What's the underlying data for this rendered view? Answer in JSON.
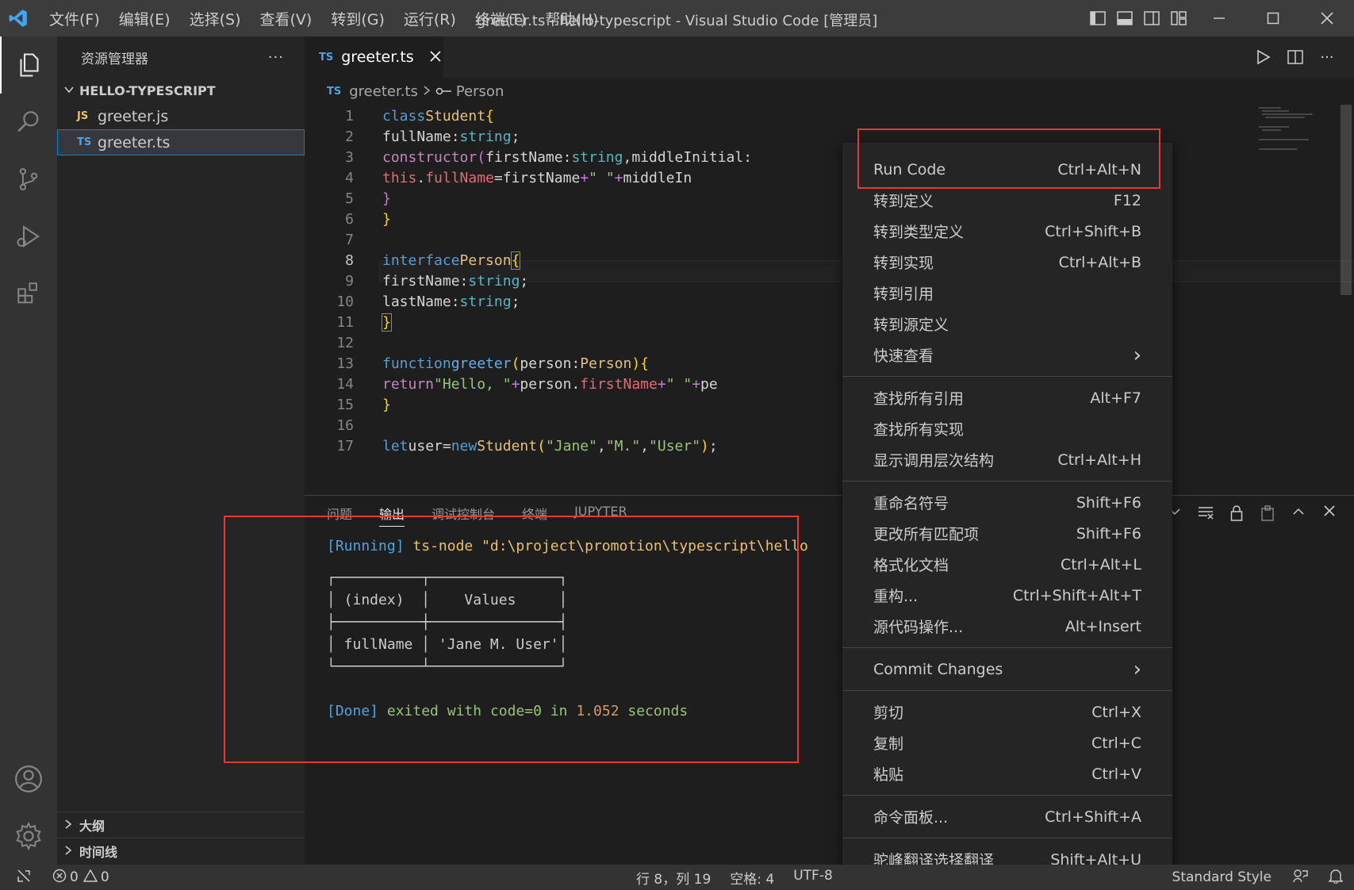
{
  "titlebar": {
    "menu": [
      "文件(F)",
      "编辑(E)",
      "选择(S)",
      "查看(V)",
      "转到(G)",
      "运行(R)",
      "终端(T)",
      "帮助(H)"
    ],
    "window_title": "greeter.ts - hello-typescript - Visual Studio Code [管理员]"
  },
  "sidebar": {
    "title": "资源管理器",
    "more": "···",
    "folder": "HELLO-TYPESCRIPT",
    "files": [
      {
        "badge": "JS",
        "name": "greeter.js"
      },
      {
        "badge": "TS",
        "name": "greeter.ts"
      }
    ],
    "outline": "大纲",
    "timeline": "时间线"
  },
  "tab": {
    "badge": "TS",
    "name": "greeter.ts"
  },
  "breadcrumb": {
    "file": "greeter.ts",
    "symbol": "Person"
  },
  "editor": {
    "current_line": 8,
    "line_numbers": [
      "1",
      "2",
      "3",
      "4",
      "5",
      "6",
      "7",
      "8",
      "9",
      "10",
      "11",
      "12",
      "13",
      "14",
      "15",
      "16",
      "17"
    ]
  },
  "panel": {
    "tabs": [
      "问题",
      "输出",
      "调试控制台",
      "终端",
      "JUPYTER"
    ],
    "active_tab": "输出",
    "running_tag": "[Running]",
    "running_cmd": "ts-node \"d:\\project\\promotion\\typescript\\hello",
    "table": {
      "top": "┌──────────┬───────────────┐",
      "header": "│ (index)  │    Values     │",
      "mid": "├──────────┼───────────────┤",
      "row": "│ fullName │ 'Jane M. User'│",
      "bottom": "└──────────┴───────────────┘"
    },
    "done_tag": "[Done]",
    "done_text": "exited with",
    "done_code": "code=0",
    "done_in": "in",
    "done_time": "1.052",
    "done_unit": "seconds"
  },
  "context_menu": {
    "groups": [
      [
        {
          "label": "Run Code",
          "kb": "Ctrl+Alt+N"
        },
        {
          "label": "转到定义",
          "kb": "F12"
        },
        {
          "label": "转到类型定义",
          "kb": "Ctrl+Shift+B"
        },
        {
          "label": "转到实现",
          "kb": "Ctrl+Alt+B"
        },
        {
          "label": "转到引用",
          "kb": ""
        },
        {
          "label": "转到源定义",
          "kb": ""
        },
        {
          "label": "快速查看",
          "kb": "›"
        }
      ],
      [
        {
          "label": "查找所有引用",
          "kb": "Alt+F7"
        },
        {
          "label": "查找所有实现",
          "kb": ""
        },
        {
          "label": "显示调用层次结构",
          "kb": "Ctrl+Alt+H"
        }
      ],
      [
        {
          "label": "重命名符号",
          "kb": "Shift+F6"
        },
        {
          "label": "更改所有匹配项",
          "kb": "Shift+F6"
        },
        {
          "label": "格式化文档",
          "kb": "Ctrl+Alt+L"
        },
        {
          "label": "重构...",
          "kb": "Ctrl+Shift+Alt+T"
        },
        {
          "label": "源代码操作...",
          "kb": "Alt+Insert"
        }
      ],
      [
        {
          "label": "Commit Changes",
          "kb": "›"
        }
      ],
      [
        {
          "label": "剪切",
          "kb": "Ctrl+X"
        },
        {
          "label": "复制",
          "kb": "Ctrl+C"
        },
        {
          "label": "粘贴",
          "kb": "Ctrl+V"
        }
      ],
      [
        {
          "label": "命令面板...",
          "kb": "Ctrl+Shift+A"
        }
      ],
      [
        {
          "label": "驼峰翻译选择翻译",
          "kb": "Shift+Alt+U"
        }
      ]
    ]
  },
  "statusbar": {
    "errors": "0",
    "warnings": "0",
    "position": "行 8，列 19",
    "spaces": "空格: 4",
    "encoding": "UTF-8",
    "style": "Standard Style"
  },
  "colors": {
    "accent": "#007acc",
    "highlight_box": "#e53935"
  }
}
